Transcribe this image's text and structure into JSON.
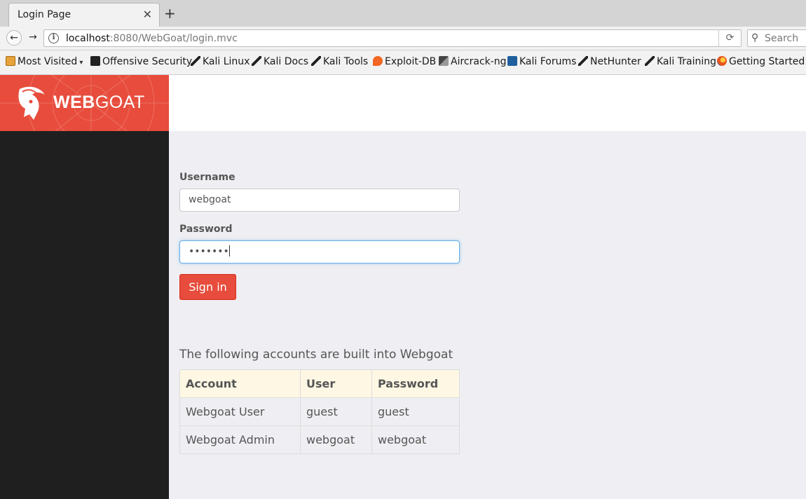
{
  "browser": {
    "tab_title": "Login Page",
    "tab_close": "✕",
    "new_tab": "+",
    "back": "←",
    "forward": "→",
    "url_host": "localhost",
    "url_rest": ":8080/WebGoat/login.mvc",
    "reload": "⟳",
    "search_placeholder": "Search"
  },
  "bookmarks": [
    {
      "label": "Most Visited",
      "icon": "folder-icon"
    },
    {
      "label": "Offensive Security",
      "icon": "offsec-icon"
    },
    {
      "label": "Kali Linux",
      "icon": "kali-icon"
    },
    {
      "label": "Kali Docs",
      "icon": "kali-icon"
    },
    {
      "label": "Kali Tools",
      "icon": "kali-icon"
    },
    {
      "label": "Exploit-DB",
      "icon": "exploit-db-icon"
    },
    {
      "label": "Aircrack-ng",
      "icon": "aircrack-icon"
    },
    {
      "label": "Kali Forums",
      "icon": "forums-icon"
    },
    {
      "label": "NetHunter",
      "icon": "kali-icon"
    },
    {
      "label": "Kali Training",
      "icon": "kali-icon"
    },
    {
      "label": "Getting Started",
      "icon": "firefox-icon"
    }
  ],
  "brand": {
    "bold": "WEB",
    "rest": "GOAT"
  },
  "login": {
    "username_label": "Username",
    "username_value": "webgoat",
    "password_label": "Password",
    "password_value": "•••••••",
    "signin_label": "Sign in"
  },
  "accounts": {
    "heading": "The following accounts are built into Webgoat",
    "headers": [
      "Account",
      "User",
      "Password"
    ],
    "rows": [
      [
        "Webgoat User",
        "guest",
        "guest"
      ],
      [
        "Webgoat Admin",
        "webgoat",
        "webgoat"
      ]
    ]
  },
  "colors": {
    "brand": "#e74c3c",
    "sidebar": "#1f1f1f",
    "table_header": "#fdf7e3"
  }
}
